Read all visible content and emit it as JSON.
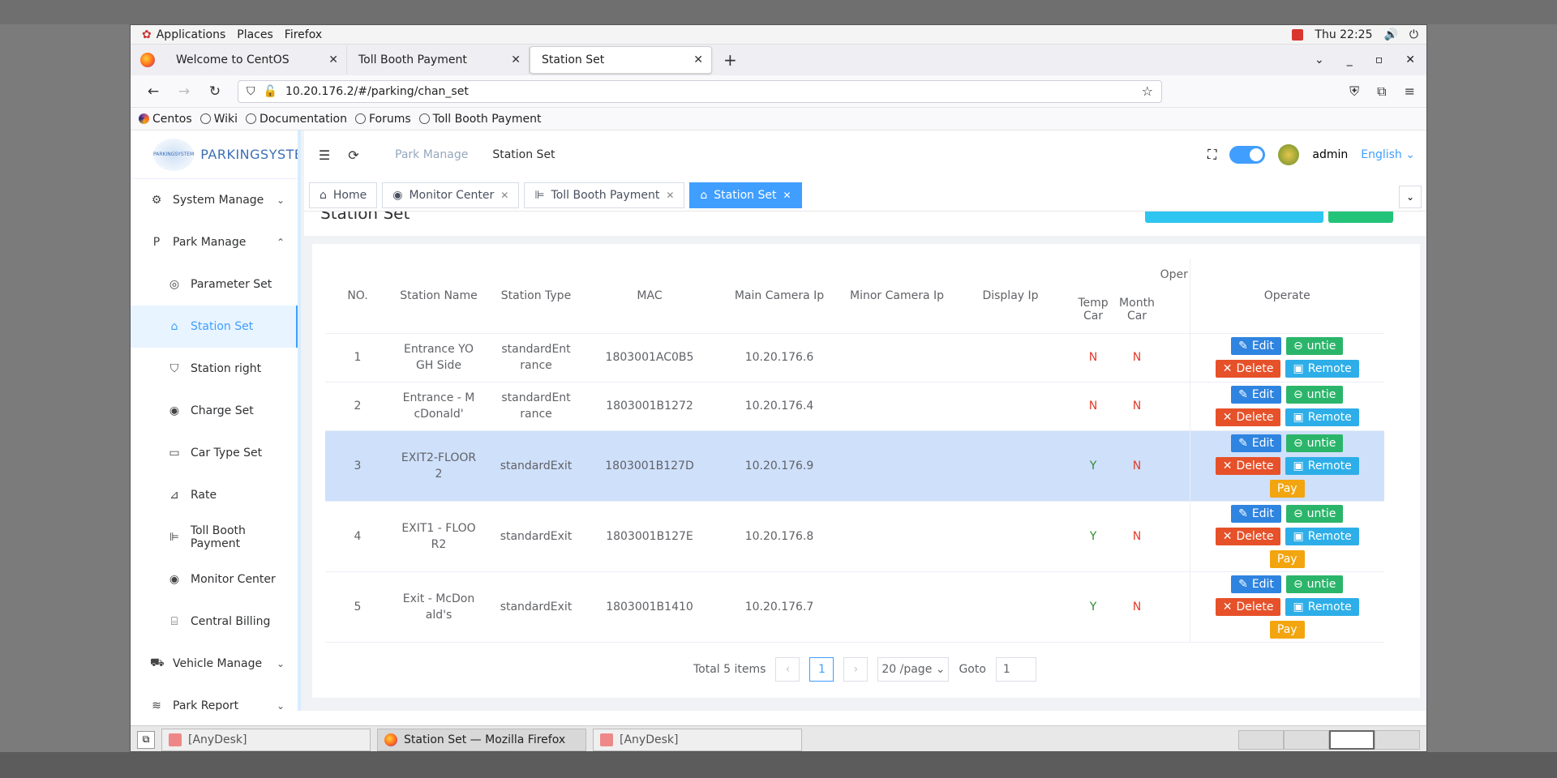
{
  "topbar": {
    "applications": "Applications",
    "places": "Places",
    "firefox": "Firefox",
    "clock": "Thu 22:25"
  },
  "tabs": [
    {
      "label": "Welcome to CentOS"
    },
    {
      "label": "Toll Booth Payment"
    },
    {
      "label": "Station Set"
    }
  ],
  "url": "10.20.176.2/#/parking/chan_set",
  "bookmarks": [
    "Centos",
    "Wiki",
    "Documentation",
    "Forums",
    "Toll Booth Payment"
  ],
  "app": {
    "logo_mark": "PARKINGSYSTEM",
    "logo_text": "PARKINGSYSTEM",
    "menu": {
      "system": "System Manage",
      "park": "Park Manage",
      "parameter": "Parameter Set",
      "station": "Station Set",
      "station_right": "Station right",
      "charge": "Charge Set",
      "cartype": "Car Type Set",
      "rate": "Rate",
      "toll": "Toll Booth Payment",
      "monitor": "Monitor Center",
      "billing": "Central Billing",
      "vehicle": "Vehicle Manage",
      "report": "Park Report"
    },
    "breadcrumb": {
      "parent": "Park Manage",
      "current": "Station Set"
    },
    "user": "admin",
    "language": "English",
    "tags": {
      "home": "Home",
      "monitor": "Monitor Center",
      "toll": "Toll Booth Payment",
      "station": "Station Set"
    },
    "page_title": "Station Set"
  },
  "table": {
    "headers": {
      "no": "NO.",
      "name": "Station Name",
      "type": "Station Type",
      "mac": "MAC",
      "main_cam": "Main Camera Ip",
      "minor_cam": "Minor Camera Ip",
      "display": "Display Ip",
      "temp": "Temp Car",
      "month": "Month Car",
      "oper": "Oper",
      "operate": "Operate"
    },
    "rows": [
      {
        "no": "1",
        "name": "Entrance YOGH Side",
        "type": "standardEntrance",
        "mac": "1803001AC0B5",
        "main": "10.20.176.6",
        "temp": "N",
        "month": "N",
        "pay": false
      },
      {
        "no": "2",
        "name": "Entrance - McDonald'",
        "type": "standardEntrance",
        "mac": "1803001B1272",
        "main": "10.20.176.4",
        "temp": "N",
        "month": "N",
        "pay": false
      },
      {
        "no": "3",
        "name": "EXIT2-FLOOR2",
        "type": "standardExit",
        "mac": "1803001B127D",
        "main": "10.20.176.9",
        "temp": "Y",
        "month": "N",
        "pay": true
      },
      {
        "no": "4",
        "name": "EXIT1 - FLOOR2",
        "type": "standardExit",
        "mac": "1803001B127E",
        "main": "10.20.176.8",
        "temp": "Y",
        "month": "N",
        "pay": true
      },
      {
        "no": "5",
        "name": "Exit - McDonald's",
        "type": "standardExit",
        "mac": "1803001B1410",
        "main": "10.20.176.7",
        "temp": "Y",
        "month": "N",
        "pay": true
      }
    ],
    "actions": {
      "edit": "Edit",
      "untie": "untie",
      "delete": "Delete",
      "remote": "Remote",
      "pay": "Pay"
    }
  },
  "pager": {
    "total": "Total 5 items",
    "page": "1",
    "size": "20 /page",
    "goto": "Goto",
    "goto_val": "1"
  },
  "taskbar": {
    "anydesk1": "[AnyDesk]",
    "firefox": "Station Set — Mozilla Firefox",
    "anydesk2": "[AnyDesk]"
  }
}
